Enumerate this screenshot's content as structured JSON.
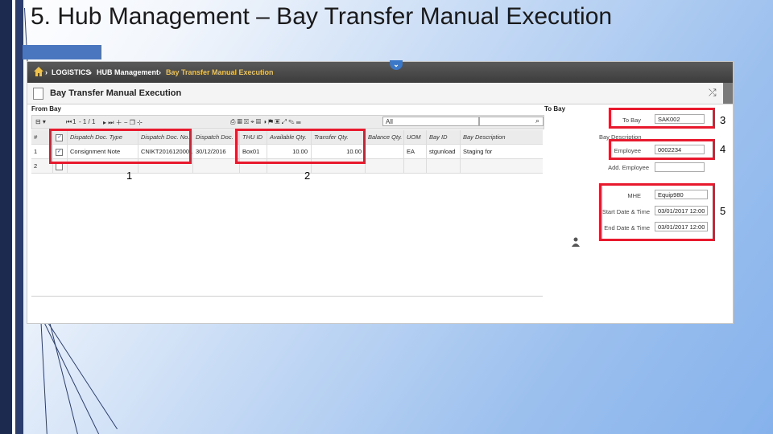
{
  "slide": {
    "title": "5. Hub Management – Bay Transfer Manual Execution"
  },
  "breadcrumb": {
    "items": [
      "LOGISTICS",
      "HUB Management",
      "Bay Transfer Manual Execution"
    ]
  },
  "screen": {
    "title": "Bay Transfer Manual Execution",
    "from_bay_label": "From Bay",
    "to_bay_label": "To Bay"
  },
  "toolbar": {
    "page_first": "1",
    "page_info": "- 1 / 1",
    "filter_value": "All"
  },
  "grid": {
    "headers": [
      "#",
      "",
      "Dispatch Doc. Type",
      "Dispatch Doc. No.",
      "Dispatch Doc.",
      "THU ID",
      "Available Qty.",
      "Transfer Qty.",
      "Balance Qty.",
      "UOM",
      "Bay ID",
      "Bay Description"
    ],
    "rows": [
      [
        "1",
        "",
        "Consignment Note",
        "CNIKT2016120001",
        "30/12/2016",
        "Box01",
        "10.00",
        "10.00",
        "",
        "EA",
        "stgunload",
        "Staging for"
      ],
      [
        "2",
        "",
        "",
        "",
        "",
        "",
        "",
        "",
        "",
        "",
        "",
        ""
      ]
    ]
  },
  "right_panel": {
    "to_bay": {
      "label": "To Bay",
      "value": "SAK002"
    },
    "bay_description": {
      "label": "Bay Description"
    },
    "employee": {
      "label": "Employee",
      "value": "0002234"
    },
    "add_employee": {
      "label": "Add. Employee"
    },
    "mhe": {
      "label": "MHE",
      "value": "Equip980"
    },
    "start": {
      "label": "Start Date & Time",
      "value": "03/01/2017 12:00"
    },
    "end": {
      "label": "End Date & Time",
      "value": "03/01/2017 12:00"
    }
  },
  "callouts": [
    "1",
    "2",
    "3",
    "4",
    "5"
  ],
  "colors": {
    "callout": "#e8192c",
    "accent": "#3b78c8",
    "crumb_highlight": "#f0c24a"
  }
}
